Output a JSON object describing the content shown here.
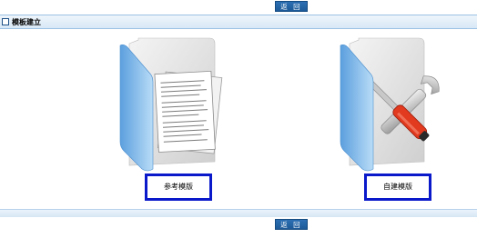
{
  "toolbar": {
    "back_label": "返 回"
  },
  "section": {
    "title": "模板建立"
  },
  "templates": [
    {
      "label": "参考模版",
      "icon": "folder-documents-icon"
    },
    {
      "label": "自建模版",
      "icon": "folder-tools-icon"
    }
  ],
  "colors": {
    "button": "#1d5a98",
    "header_border": "#9cc2e6",
    "label_border": "#0a1acb",
    "folder_blue": "#8cc3ef",
    "tool_red": "#e23a1e"
  }
}
